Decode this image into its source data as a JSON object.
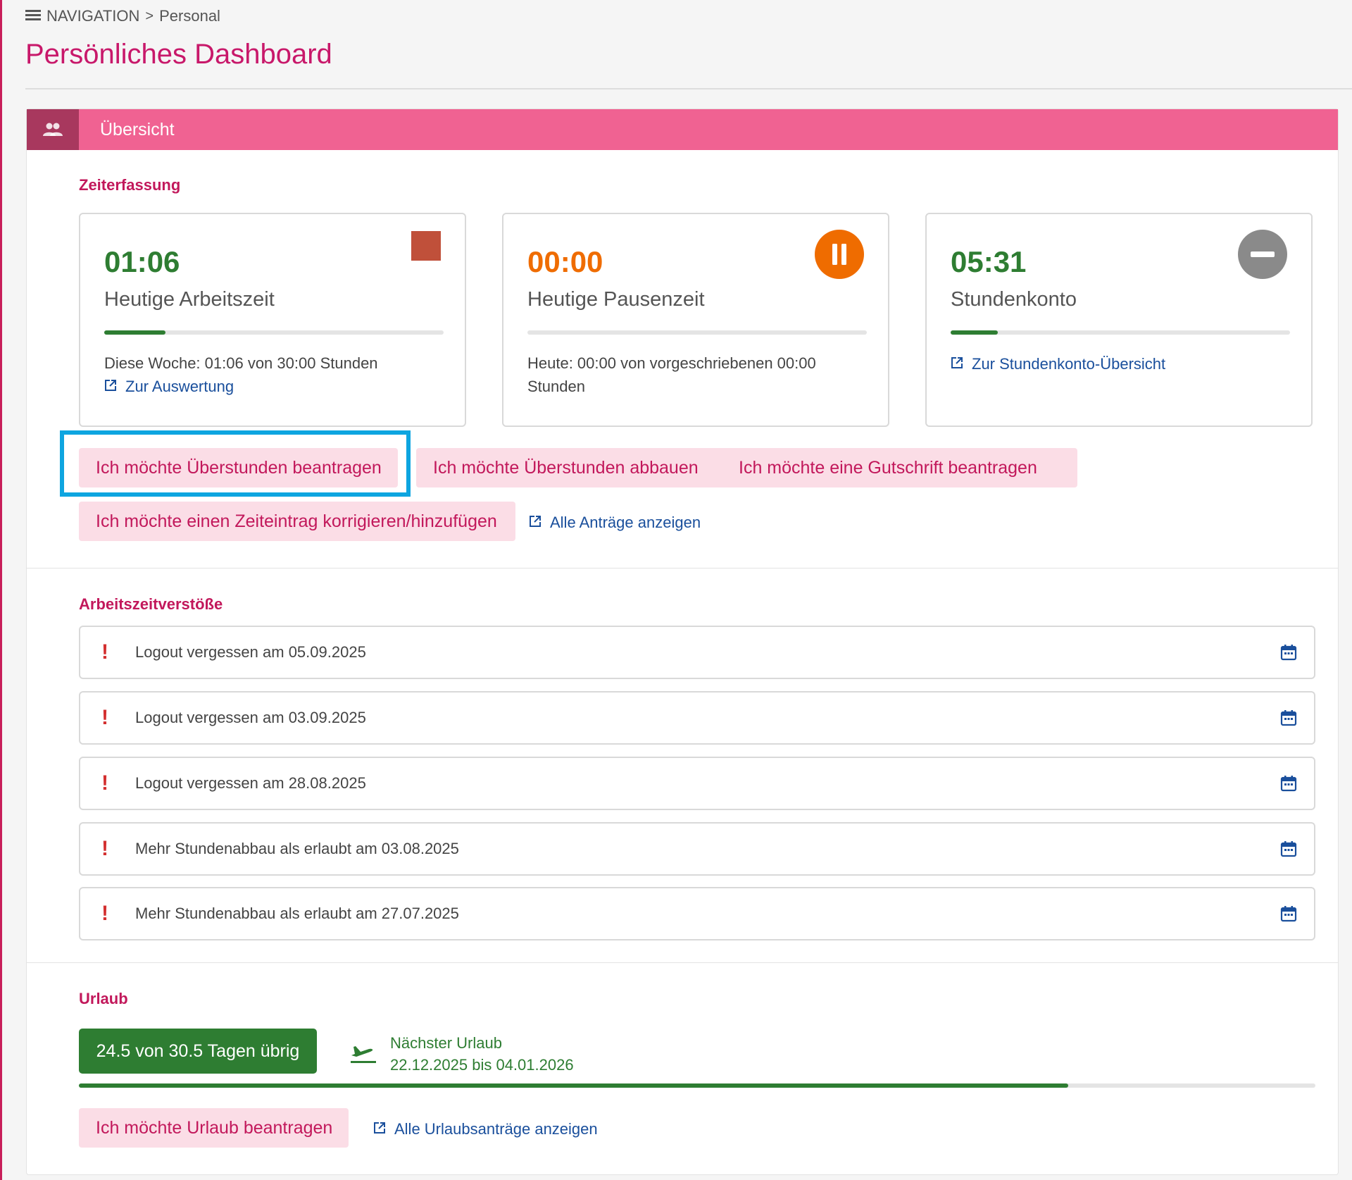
{
  "breadcrumb": {
    "nav_label": "NAVIGATION",
    "current": "Personal"
  },
  "page": {
    "title": "Persönliches Dashboard"
  },
  "overview": {
    "title": "Übersicht"
  },
  "time_tracking": {
    "label": "Zeiterfassung",
    "work": {
      "value": "01:06",
      "label": "Heutige Arbeitszeit",
      "progress_fraction": 0.18,
      "info": "Diese Woche: 01:06 von 30:00 Stunden",
      "link": "Zur Auswertung",
      "icon": "stop-icon"
    },
    "pause": {
      "value": "00:00",
      "label": "Heutige Pausenzeit",
      "progress_fraction": 0,
      "info": "Heute: 00:00 von vorgeschriebenen 00:00 Stunden",
      "icon": "pause-icon"
    },
    "balance": {
      "value": "05:31",
      "label": "Stundenkonto",
      "progress_fraction": 0.14,
      "link": "Zur Stundenkonto-Übersicht",
      "icon": "minus-circle-icon"
    },
    "actions": {
      "request_overtime": "Ich möchte Überstunden beantragen",
      "reduce_overtime": "Ich möchte Überstunden abbauen",
      "request_credit": "Ich möchte eine Gutschrift beantragen",
      "correct_entry": "Ich möchte einen Zeiteintrag korrigieren/hinzufügen",
      "all_requests": "Alle Anträge anzeigen"
    }
  },
  "violations": {
    "label": "Arbeitszeitverstöße",
    "items": [
      {
        "text": "Logout vergessen am 05.09.2025"
      },
      {
        "text": "Logout vergessen am 03.09.2025"
      },
      {
        "text": "Logout vergessen am 28.08.2025"
      },
      {
        "text": "Mehr Stundenabbau als erlaubt am 03.08.2025"
      },
      {
        "text": "Mehr Stundenabbau als erlaubt am 27.07.2025"
      }
    ]
  },
  "vacation": {
    "label": "Urlaub",
    "remaining": "24.5 von 30.5 Tagen übrig",
    "remaining_fraction": 0.8,
    "next_label": "Nächster Urlaub",
    "next_dates": "22.12.2025 bis 04.01.2026",
    "request": "Ich möchte Urlaub beantragen",
    "all_requests": "Alle Urlaubsanträge anzeigen"
  },
  "colors": {
    "accent": "#c2185b",
    "header": "#f06292",
    "work": "#2e7d32",
    "pause": "#ef6c00",
    "stop": "#c0503a",
    "link": "#1a4f9c",
    "highlight": "#0ea5e0"
  }
}
